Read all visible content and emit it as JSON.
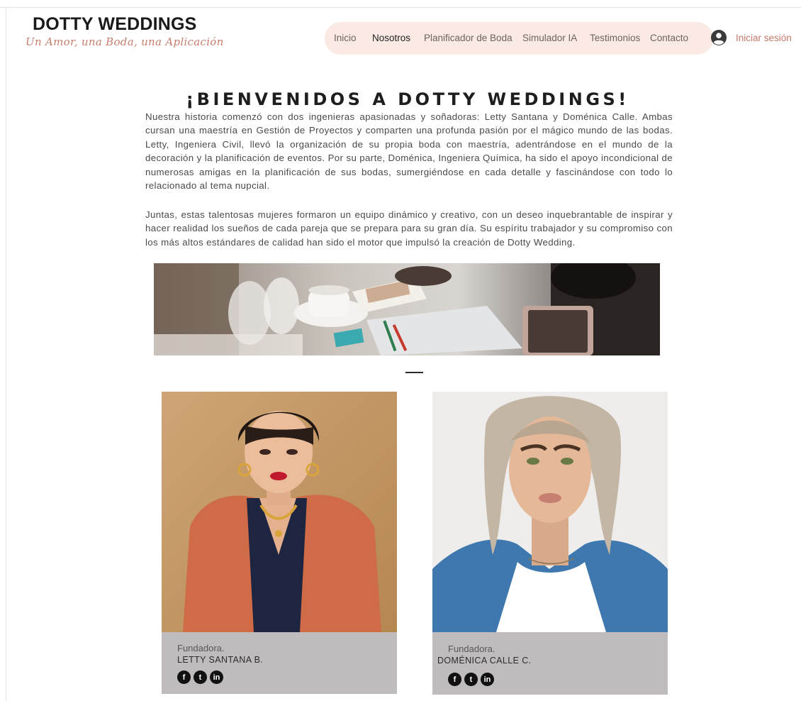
{
  "brand": {
    "title": "DOTTY WEDDINGS",
    "tagline": "Un Amor, una Boda, una Aplicación"
  },
  "nav": {
    "items": [
      "Inicio",
      "Nosotros",
      "Planificador de Boda",
      "Simulador IA",
      "Testimonios",
      "Contacto"
    ],
    "active": "Nosotros"
  },
  "login": {
    "label": "Iniciar sesión",
    "icon": "user-avatar-icon"
  },
  "intro": {
    "heading": "¡BIENVENIDOS A DOTTY WEDDINGS!",
    "paragraph_1": "Nuestra historia comenzó con dos ingenieras apasionadas y soñadoras: Letty Santana y Doménica Calle. Ambas cursan una maestría en Gestión de Proyectos y comparten una profunda pasión por el mágico mundo de las bodas. Letty, Ingeniera Civil, llevó la organización de su propia boda con maestría, adentrándose en el mundo de la decoración y la planificación de eventos. Por su parte, Doménica, Ingeniera Química, ha sido el apoyo incondicional de numerosas amigas en la planificación de sus bodas, sumergiéndose en cada detalle y fascinándose con todo lo relacionado al tema nupcial.",
    "paragraph_2": "Juntas, estas talentosas mujeres formaron un equipo dinámico y creativo, con un deseo inquebrantable de inspirar y hacer realidad los sueños de cada pareja que se prepara para su gran día. Su espíritu trabajador y su compromiso con los más altos estándares de calidad han sido el motor que impulsó la creación de Dotty Wedding."
  },
  "founders": [
    {
      "role": "Fundadora.",
      "name": "LETTY SANTANA B.",
      "social": [
        "f",
        "t",
        "in"
      ]
    },
    {
      "role": "Fundadora.",
      "name": "DOMÉNICA CALLE C.",
      "social": [
        "f",
        "t",
        "in"
      ]
    }
  ],
  "colors": {
    "nav_background": "#fbe9e4",
    "tagline": "#c77f71",
    "login_label": "#c4786a",
    "card_background": "#c0bcbd"
  }
}
